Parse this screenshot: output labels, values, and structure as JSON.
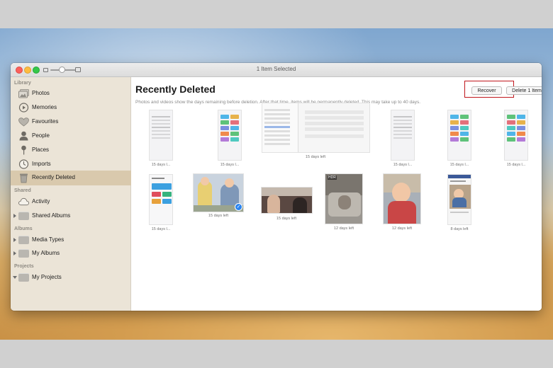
{
  "window": {
    "title": "1 Item Selected"
  },
  "sidebar": {
    "sections": {
      "library": "Library",
      "shared": "Shared",
      "albums": "Albums",
      "projects": "Projects"
    },
    "library_items": [
      {
        "label": "Photos",
        "icon": "photos-icon"
      },
      {
        "label": "Memories",
        "icon": "memories-icon"
      },
      {
        "label": "Favourites",
        "icon": "heart-icon"
      },
      {
        "label": "People",
        "icon": "person-icon"
      },
      {
        "label": "Places",
        "icon": "pin-icon"
      },
      {
        "label": "Imports",
        "icon": "clock-icon"
      },
      {
        "label": "Recently Deleted",
        "icon": "trash-icon",
        "selected": true
      }
    ],
    "shared_items": [
      {
        "label": "Activity",
        "icon": "cloud-icon"
      },
      {
        "label": "Shared Albums",
        "icon": "folder-icon"
      }
    ],
    "album_items": [
      {
        "label": "Media Types",
        "icon": "folder-icon"
      },
      {
        "label": "My Albums",
        "icon": "folder-icon"
      }
    ],
    "project_items": [
      {
        "label": "My Projects",
        "icon": "folder-icon"
      }
    ]
  },
  "main": {
    "title": "Recently Deleted",
    "subtitle": "Photos and videos show the days remaining before deletion. After that time, items will be permanently deleted. This may take up to 40 days.",
    "recover_label": "Recover",
    "delete_label": "Delete 1 Item",
    "items": [
      {
        "caption": "15 days l...",
        "kind": "phone-settings"
      },
      {
        "caption": "15 days l...",
        "kind": "phone-tiles"
      },
      {
        "caption": "15 days left",
        "kind": "ipad-settings"
      },
      {
        "caption": "15 days l...",
        "kind": "phone-settings"
      },
      {
        "caption": "15 days l...",
        "kind": "phone-tiles"
      },
      {
        "caption": "15 days l...",
        "kind": "phone-tiles"
      },
      {
        "caption": "15 days l...",
        "kind": "phone-tiles"
      },
      {
        "caption": "15 days left",
        "kind": "photo-kids",
        "selected": true
      },
      {
        "caption": "15 days left",
        "kind": "photo-family"
      },
      {
        "caption": "12 days left",
        "kind": "photo-bed",
        "badge": "HDR"
      },
      {
        "caption": "12 days left",
        "kind": "photo-baby"
      },
      {
        "caption": "8 days left",
        "kind": "phone-photo-post"
      }
    ]
  },
  "colors": {
    "sidebar_bg": "#ebe4d7",
    "sidebar_selected": "#d9c9ad",
    "highlight_box": "#c0161c",
    "selection_badge": "#2a84f0"
  }
}
